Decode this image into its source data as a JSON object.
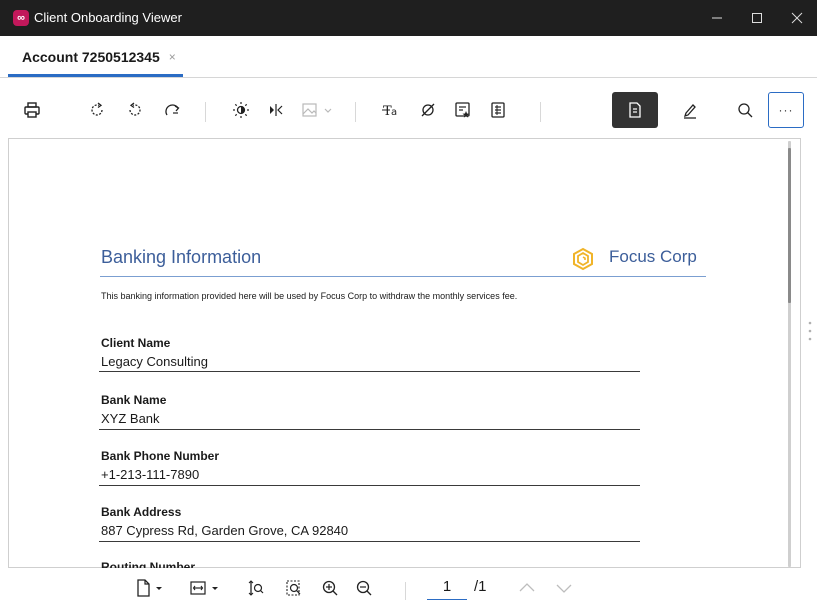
{
  "window": {
    "title": "Client Onboarding Viewer",
    "app_icon_text": "∞"
  },
  "tabs": [
    {
      "label": "Account 7250512345",
      "close": "×"
    }
  ],
  "toolbar": {
    "icons": [
      "print-icon",
      "rotate-clockwise-icon",
      "rotate-counterclockwise-icon",
      "redo-icon",
      "brightness-icon",
      "flip-horizontal-icon",
      "image-dropdown-icon",
      "text-size-icon",
      "hide-icon",
      "form-fields-icon",
      "document-list-icon",
      "document-icon",
      "sign-pen-icon",
      "search-icon",
      "more-icon"
    ],
    "more_label": "···"
  },
  "document": {
    "title": "Banking Information",
    "brand": "Focus Corp",
    "notice": "This banking information provided here will be used by Focus Corp to withdraw the monthly services fee.",
    "fields": [
      {
        "label": "Client Name",
        "value": "Legacy Consulting"
      },
      {
        "label": "Bank Name",
        "value": "XYZ Bank"
      },
      {
        "label": "Bank Phone Number",
        "value": "+1-213-111-7890"
      },
      {
        "label": "Bank Address",
        "value": "887 Cypress Rd, Garden Grove, CA 92840"
      }
    ],
    "next_field_partial": "Routing Number"
  },
  "pager": {
    "current_page": "1",
    "total": "/1"
  },
  "colors": {
    "accent": "#2b6cc4",
    "heading": "#3c5e9a",
    "brand_logo": "#f0b429",
    "titlebar": "#1f1f1f"
  }
}
